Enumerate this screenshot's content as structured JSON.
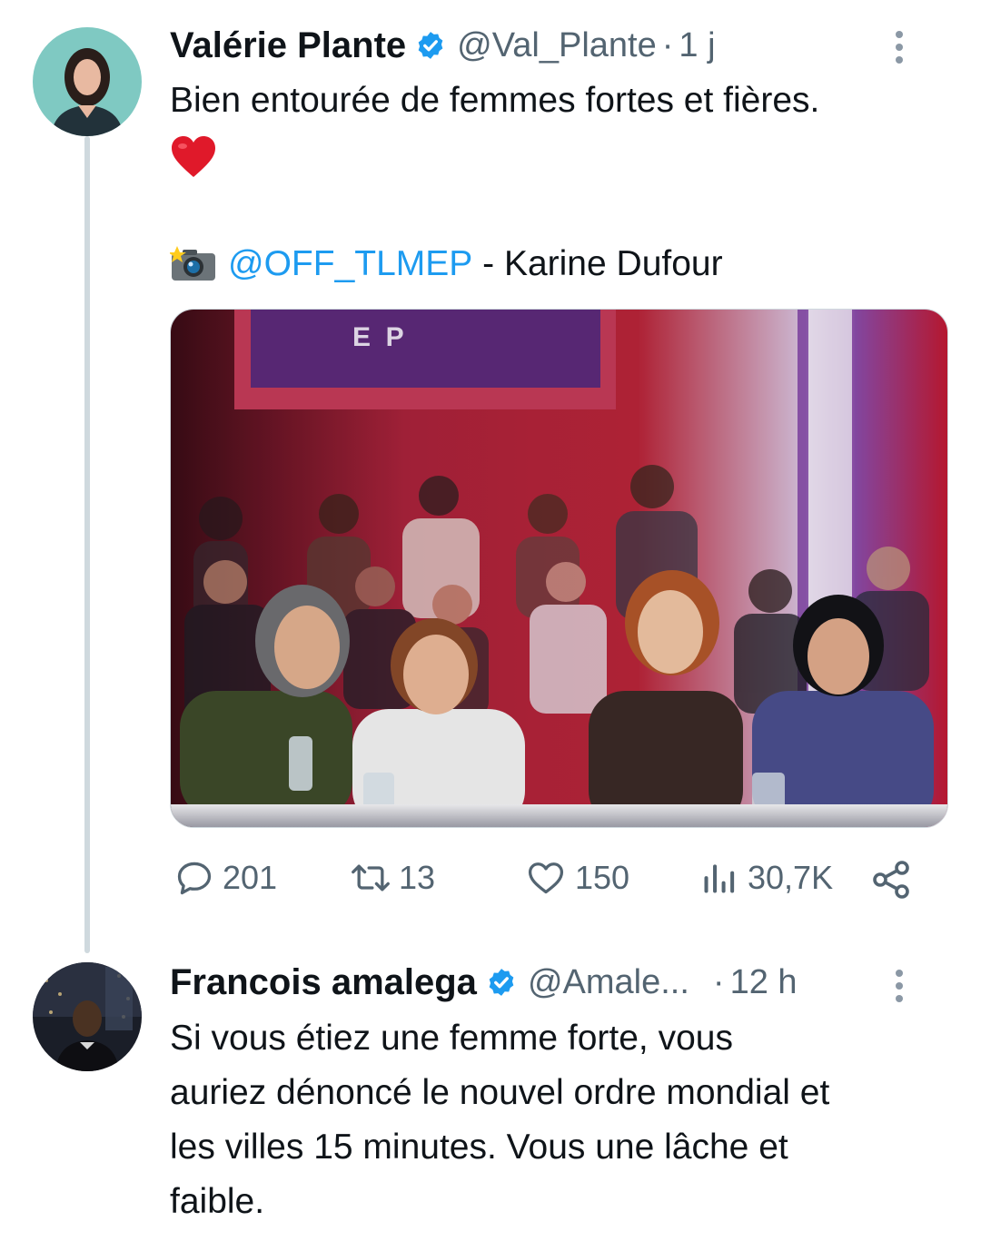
{
  "main_tweet": {
    "author_name": "Valérie Plante",
    "handle": "@Val_Plante",
    "separator": "·",
    "time": "1 j",
    "text_line1": "Bien entourée de femmes fortes et fières.",
    "heart_emoji": "❤️",
    "camera_emoji": "📸",
    "credit_mention": "@OFF_TLMEP",
    "credit_text": " - Karine Dufour",
    "media_sign_text": "E  P",
    "stats": {
      "replies": "201",
      "retweets": "13",
      "likes": "150",
      "views": "30,7K"
    }
  },
  "reply_tweet": {
    "author_name": "Francois amalega",
    "handle": "@Amale...",
    "separator": "·",
    "time": "12 h",
    "text_lines": [
      "Si vous étiez une femme forte, vous",
      "auriez dénoncé le nouvel ordre mondial et",
      "les villes 15 minutes. Vous une lâche et",
      "faible."
    ]
  },
  "colors": {
    "accent": "#1d9bf0",
    "secondary_text": "#536471",
    "thread_line": "#cfd9de"
  }
}
